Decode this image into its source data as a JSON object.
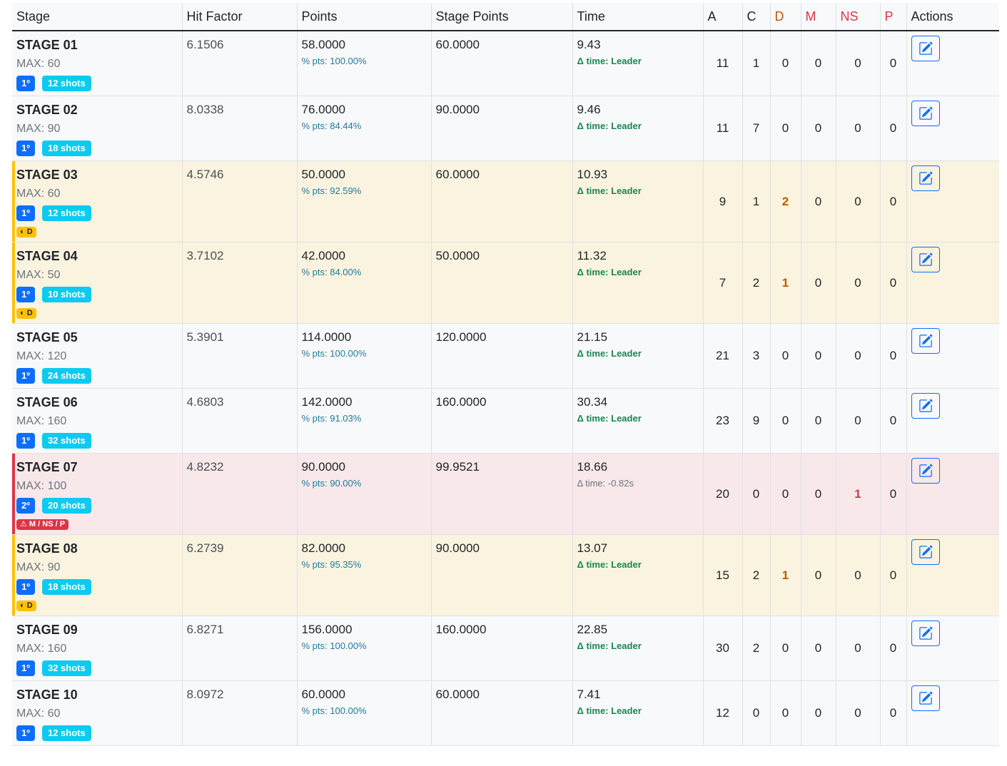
{
  "header": {
    "stage": "Stage",
    "hit_factor": "Hit Factor",
    "points": "Points",
    "stage_points": "Stage Points",
    "time": "Time",
    "a": "A",
    "c": "C",
    "d": "D",
    "m": "M",
    "ns": "NS",
    "p": "P",
    "actions": "Actions"
  },
  "colors": {
    "rank": "#0d6efd",
    "shots": "#0dcaf0",
    "warn": "#ffc107",
    "danger": "#dc3545"
  },
  "rows": [
    {
      "stage": "STAGE 01",
      "max": "MAX: 60",
      "rank": "1º",
      "shots": "12 shots",
      "flag": "",
      "hf": "6.1506",
      "points": "58.0000",
      "pct": "% pts: 100.00%",
      "stage_points": "60.0000",
      "time": "9.43",
      "delta": "Δ time: Leader",
      "a": "11",
      "c": "1",
      "d": "0",
      "m": "0",
      "ns": "0",
      "p": "0",
      "status": "normal"
    },
    {
      "stage": "STAGE 02",
      "max": "MAX: 90",
      "rank": "1º",
      "shots": "18 shots",
      "flag": "",
      "hf": "8.0338",
      "points": "76.0000",
      "pct": "% pts: 84.44%",
      "stage_points": "90.0000",
      "time": "9.46",
      "delta": "Δ time: Leader",
      "a": "11",
      "c": "7",
      "d": "0",
      "m": "0",
      "ns": "0",
      "p": "0",
      "status": "normal"
    },
    {
      "stage": "STAGE 03",
      "max": "MAX: 60",
      "rank": "1º",
      "shots": "12 shots",
      "flag": "◐ D",
      "hf": "4.5746",
      "points": "50.0000",
      "pct": "% pts: 92.59%",
      "stage_points": "60.0000",
      "time": "10.93",
      "delta": "Δ time: Leader",
      "a": "9",
      "c": "1",
      "d": "2",
      "m": "0",
      "ns": "0",
      "p": "0",
      "status": "warn"
    },
    {
      "stage": "STAGE 04",
      "max": "MAX: 50",
      "rank": "1º",
      "shots": "10 shots",
      "flag": "◐ D",
      "hf": "3.7102",
      "points": "42.0000",
      "pct": "% pts: 84.00%",
      "stage_points": "50.0000",
      "time": "11.32",
      "delta": "Δ time: Leader",
      "a": "7",
      "c": "2",
      "d": "1",
      "m": "0",
      "ns": "0",
      "p": "0",
      "status": "warn"
    },
    {
      "stage": "STAGE 05",
      "max": "MAX: 120",
      "rank": "1º",
      "shots": "24 shots",
      "flag": "",
      "hf": "5.3901",
      "points": "114.0000",
      "pct": "% pts: 100.00%",
      "stage_points": "120.0000",
      "time": "21.15",
      "delta": "Δ time: Leader",
      "a": "21",
      "c": "3",
      "d": "0",
      "m": "0",
      "ns": "0",
      "p": "0",
      "status": "normal"
    },
    {
      "stage": "STAGE 06",
      "max": "MAX: 160",
      "rank": "1º",
      "shots": "32 shots",
      "flag": "",
      "hf": "4.6803",
      "points": "142.0000",
      "pct": "% pts: 91.03%",
      "stage_points": "160.0000",
      "time": "30.34",
      "delta": "Δ time: Leader",
      "a": "23",
      "c": "9",
      "d": "0",
      "m": "0",
      "ns": "0",
      "p": "0",
      "status": "normal"
    },
    {
      "stage": "STAGE 07",
      "max": "MAX: 100",
      "rank": "2º",
      "shots": "20 shots",
      "flag": "⚠ M / NS / P",
      "hf": "4.8232",
      "points": "90.0000",
      "pct": "% pts: 90.00%",
      "stage_points": "99.9521",
      "time": "18.66",
      "delta": "Δ time: -0.82s",
      "a": "20",
      "c": "0",
      "d": "0",
      "m": "0",
      "ns": "1",
      "p": "0",
      "status": "danger"
    },
    {
      "stage": "STAGE 08",
      "max": "MAX: 90",
      "rank": "1º",
      "shots": "18 shots",
      "flag": "◐ D",
      "hf": "6.2739",
      "points": "82.0000",
      "pct": "% pts: 95.35%",
      "stage_points": "90.0000",
      "time": "13.07",
      "delta": "Δ time: Leader",
      "a": "15",
      "c": "2",
      "d": "1",
      "m": "0",
      "ns": "0",
      "p": "0",
      "status": "warn"
    },
    {
      "stage": "STAGE 09",
      "max": "MAX: 160",
      "rank": "1º",
      "shots": "32 shots",
      "flag": "",
      "hf": "6.8271",
      "points": "156.0000",
      "pct": "% pts: 100.00%",
      "stage_points": "160.0000",
      "time": "22.85",
      "delta": "Δ time: Leader",
      "a": "30",
      "c": "2",
      "d": "0",
      "m": "0",
      "ns": "0",
      "p": "0",
      "status": "normal"
    },
    {
      "stage": "STAGE 10",
      "max": "MAX: 60",
      "rank": "1º",
      "shots": "12 shots",
      "flag": "",
      "hf": "8.0972",
      "points": "60.0000",
      "pct": "% pts: 100.00%",
      "stage_points": "60.0000",
      "time": "7.41",
      "delta": "Δ time: Leader",
      "a": "12",
      "c": "0",
      "d": "0",
      "m": "0",
      "ns": "0",
      "p": "0",
      "status": "normal"
    }
  ]
}
